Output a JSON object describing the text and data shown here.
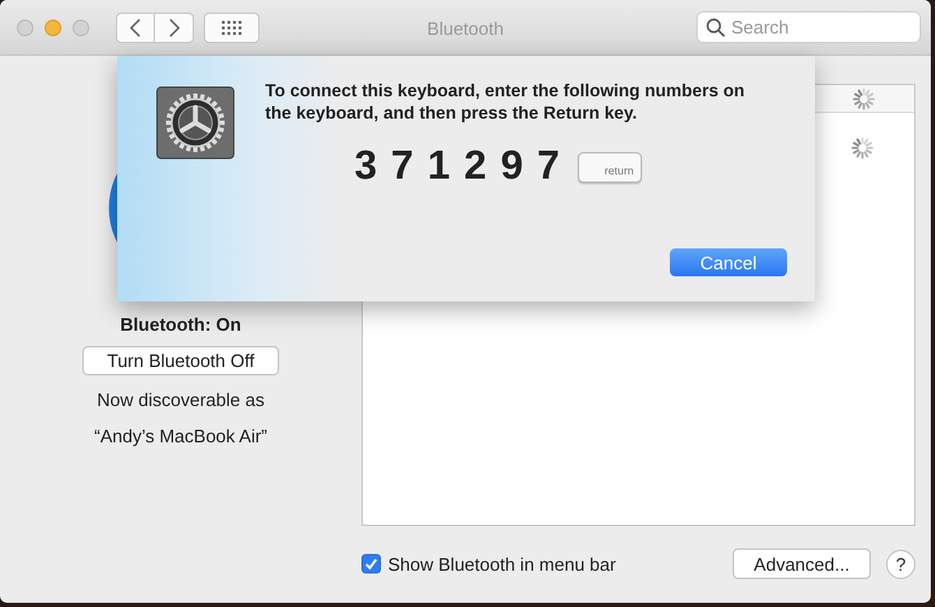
{
  "window": {
    "title": "Bluetooth"
  },
  "search": {
    "placeholder": "Search"
  },
  "sheet": {
    "message": "To connect this keyboard, enter the following numbers on the keyboard, and then press the Return key.",
    "code": "3 7 1 2 9 7",
    "key_label": "return",
    "buttons": [
      "Cancel"
    ]
  },
  "status": {
    "label": "Bluetooth: On",
    "toggle_button": "Turn Bluetooth Off",
    "discoverable": "Now discoverable as",
    "device_name": "“Andy’s MacBook Air”"
  },
  "devices": {
    "loading": true
  },
  "footer": {
    "menu_bar_checkbox": {
      "label": "Show Bluetooth in menu bar",
      "checked": true
    },
    "advanced_button": "Advanced...",
    "help_button": "?"
  }
}
